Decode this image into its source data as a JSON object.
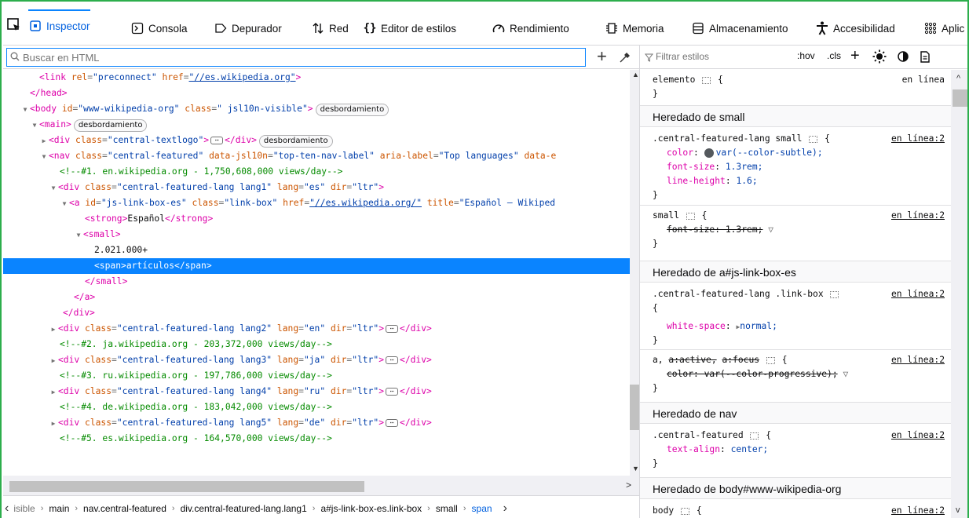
{
  "colors": {
    "accent": "#0a84ff",
    "selection": "#0a84ff",
    "tag": "#dd00a9",
    "attr_name": "#cc5500",
    "attr_value": "#003eaa",
    "comment": "#058b00",
    "frame_border": "#2cae4c"
  },
  "tabs": [
    {
      "label": "Inspector",
      "icon": "inspector-icon"
    },
    {
      "label": "Consola",
      "icon": "console-icon"
    },
    {
      "label": "Depurador",
      "icon": "debugger-icon"
    },
    {
      "label": "Red",
      "icon": "network-icon"
    },
    {
      "label": "Editor de estilos",
      "icon": "style-editor-icon"
    },
    {
      "label": "Rendimiento",
      "icon": "performance-icon"
    },
    {
      "label": "Memoria",
      "icon": "memory-icon"
    },
    {
      "label": "Almacenamiento",
      "icon": "storage-icon"
    },
    {
      "label": "Accesibilidad",
      "icon": "accessibility-icon"
    },
    {
      "label": "Aplic",
      "icon": "application-icon"
    }
  ],
  "search": {
    "placeholder": "Buscar en HTML",
    "add_node": "+"
  },
  "markup": {
    "head_link": {
      "tag": "<link",
      "a1": "rel",
      "v1": "\"preconnect\"",
      "a2": "href",
      "v2": "\"//es.wikipedia.org\"",
      "close": ">"
    },
    "head_close": "</head>",
    "body_open": {
      "tag": "<body",
      "a1": "id",
      "v1": "\"www-wikipedia-org\"",
      "a2": "class",
      "v2": "\" jsl10n-visible\"",
      "close": ">",
      "badge": "desbordamiento"
    },
    "main_open": {
      "tag": "<main>",
      "badge": "desbordamiento"
    },
    "textlogo": {
      "tag": "<div",
      "a1": "class",
      "v1": "\"central-textlogo\"",
      "close": ">",
      "end": "</div>",
      "badge": "desbordamiento"
    },
    "nav_open": {
      "tag": "<nav",
      "a1": "class",
      "v1": "\"central-featured\"",
      "a2": "data-jsl10n",
      "v2": "\"top-ten-nav-label\"",
      "a3": "aria-label",
      "v3": "\"Top languages\"",
      "a4": "data-e"
    },
    "comment1": "<!--#1. en.wikipedia.org - 1,750,608,000 views/day-->",
    "div_lang1": {
      "tag": "<div",
      "a1": "class",
      "v1": "\"central-featured-lang lang1\"",
      "a2": "lang",
      "v2": "\"es\"",
      "a3": "dir",
      "v3": "\"ltr\"",
      "close": ">"
    },
    "a_open": {
      "tag": "<a",
      "a1": "id",
      "v1": "\"js-link-box-es\"",
      "a2": "class",
      "v2": "\"link-box\"",
      "a3": "href",
      "v3": "\"//es.wikipedia.org/\"",
      "a4": "title",
      "v4": "\"Español — Wikiped"
    },
    "strong": {
      "open": "<strong>",
      "text": "Español",
      "close": "</strong>"
    },
    "small_open": "<small>",
    "count_text": "2.021.000+",
    "span": {
      "open": "<span>",
      "text": "artículos",
      "close": "</span>"
    },
    "small_close": "</small>",
    "a_close": "</a>",
    "div_close": "</div>",
    "div_lang2": {
      "tag": "<div",
      "a1": "class",
      "v1": "\"central-featured-lang lang2\"",
      "a2": "lang",
      "v2": "\"en\"",
      "a3": "dir",
      "v3": "\"ltr\"",
      "close": ">",
      "end": "</div>"
    },
    "comment2": "<!--#2. ja.wikipedia.org - 203,372,000 views/day-->",
    "div_lang3": {
      "tag": "<div",
      "a1": "class",
      "v1": "\"central-featured-lang lang3\"",
      "a2": "lang",
      "v2": "\"ja\"",
      "a3": "dir",
      "v3": "\"ltr\"",
      "close": ">",
      "end": "</div>"
    },
    "comment3": "<!--#3. ru.wikipedia.org - 197,786,000 views/day-->",
    "div_lang4": {
      "tag": "<div",
      "a1": "class",
      "v1": "\"central-featured-lang lang4\"",
      "a2": "lang",
      "v2": "\"ru\"",
      "a3": "dir",
      "v3": "\"ltr\"",
      "close": ">",
      "end": "</div>"
    },
    "comment4": "<!--#4. de.wikipedia.org - 183,042,000 views/day-->",
    "div_lang5": {
      "tag": "<div",
      "a1": "class",
      "v1": "\"central-featured-lang lang5\"",
      "a2": "lang",
      "v2": "\"de\"",
      "a3": "dir",
      "v3": "\"ltr\"",
      "close": ">",
      "end": "</div>"
    },
    "comment5": "<!--#5. es.wikipedia.org - 164,570,000 views/day-->"
  },
  "breadcrumbs": [
    "isible",
    "main",
    "nav.central-featured",
    "div.central-featured-lang.lang1",
    "a#js-link-box-es.link-box",
    "small",
    "span"
  ],
  "rules_toolbar": {
    "filter_placeholder": "Filtrar estilos",
    "hov": ":hov",
    "cls": ".cls",
    "add": "+"
  },
  "rules": {
    "element": {
      "selector": "elemento",
      "brace": "{",
      "source": "en línea",
      "close": "}"
    },
    "h_small": "Heredado de small",
    "r1": {
      "selector": ".central-featured-lang small",
      "brace": "{",
      "source": "en línea:2",
      "p1": "color",
      "v1": "var(--color-subtle);",
      "p2": "font-size",
      "v2": "1.3rem;",
      "p3": "line-height",
      "v3": "1.6;",
      "close": "}"
    },
    "r2": {
      "selector": "small",
      "brace": "{",
      "source": "en línea:2",
      "p1": "font-size: 1.3rem;",
      "close": "}"
    },
    "h_a": "Heredado de a#js-link-box-es",
    "r3": {
      "selector": ".central-featured-lang .link-box",
      "source": "en línea:2",
      "brace": "{",
      "p1": "white-space",
      "v1": "normal;",
      "close": "}"
    },
    "r4": {
      "selector": "a,",
      "sel2": "a:active,",
      "sel3": "a:focus",
      "brace": "{",
      "source": "en línea:2",
      "p1": "color: var(--color-progressive);",
      "close": "}"
    },
    "h_nav": "Heredado de nav",
    "r5": {
      "selector": ".central-featured",
      "brace": "{",
      "source": "en línea:2",
      "p1": "text-align",
      "v1": "center;",
      "close": "}"
    },
    "h_body": "Heredado de body#www-wikipedia-org",
    "r6": {
      "selector": "body",
      "brace": "{",
      "source": "en línea:2"
    }
  }
}
